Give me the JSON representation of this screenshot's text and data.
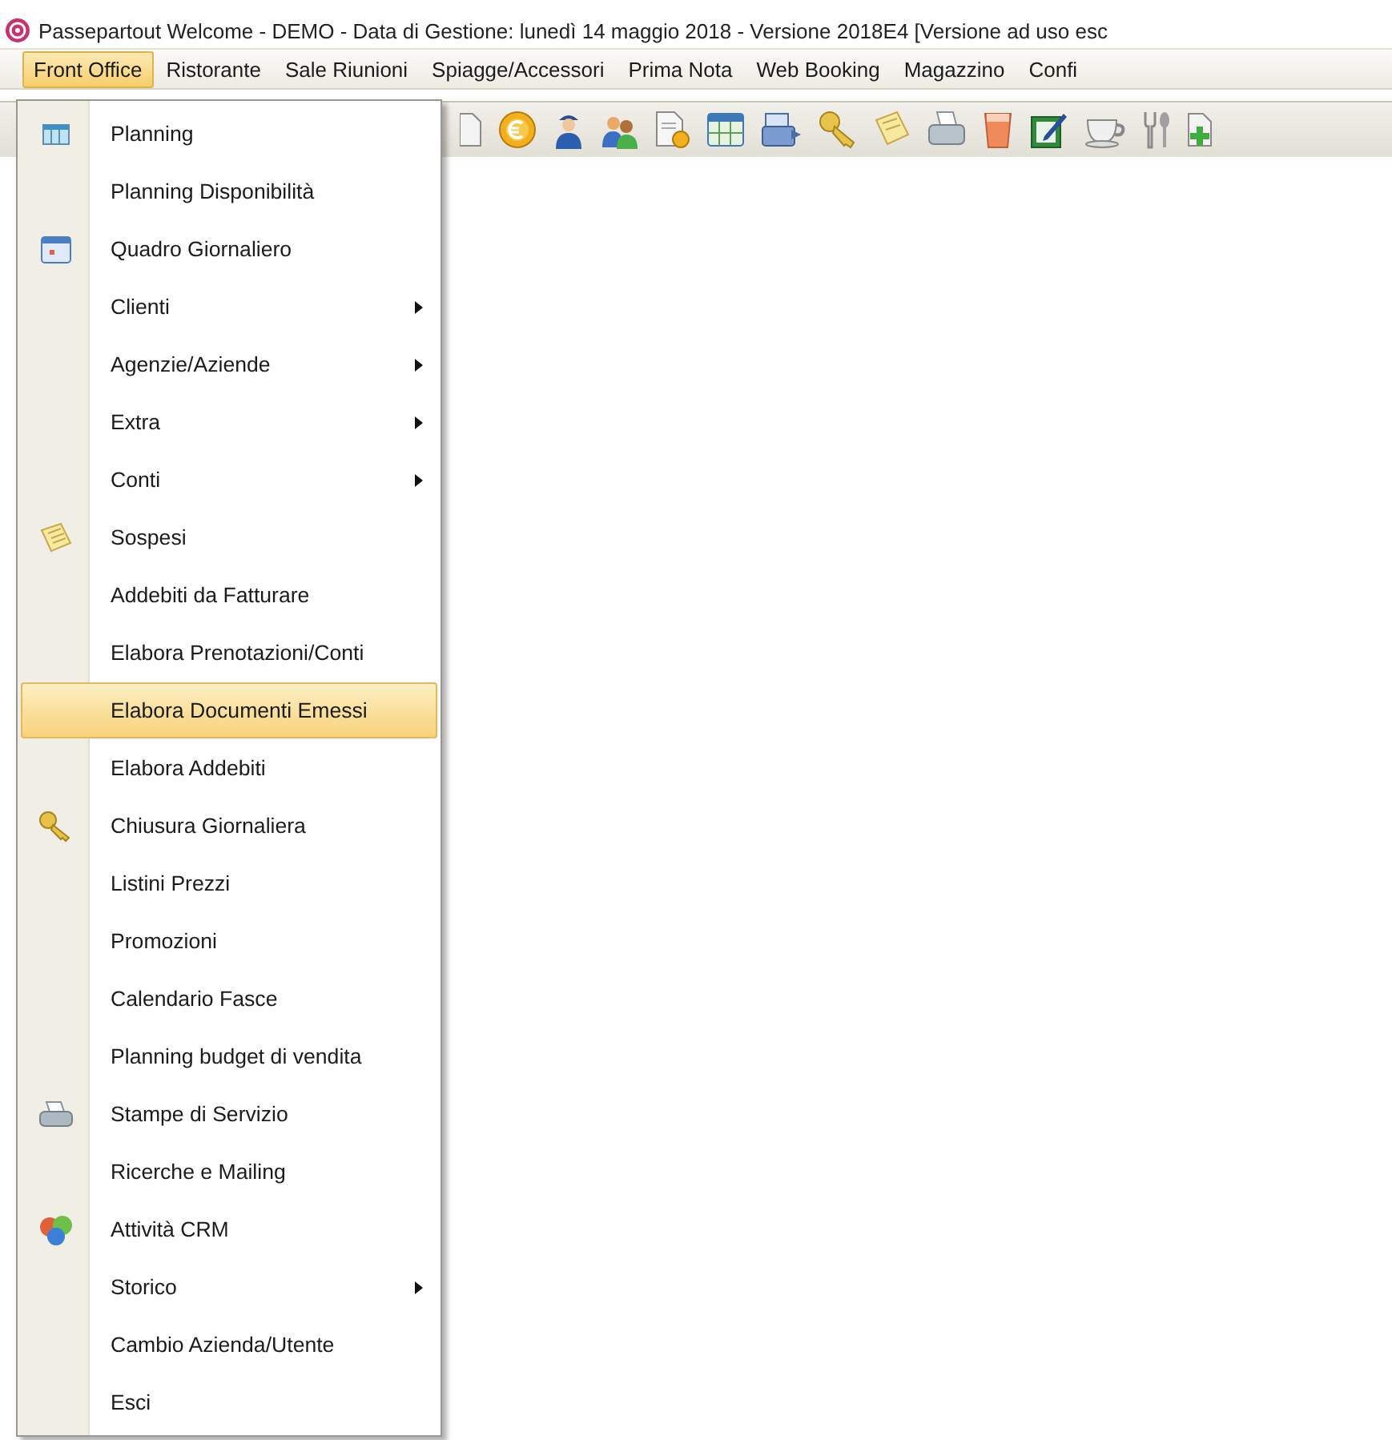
{
  "window": {
    "title": "Passepartout Welcome - DEMO - Data di Gestione: lunedì 14 maggio 2018 - Versione 2018E4 [Versione ad uso esc"
  },
  "menu_bar": [
    {
      "label": "Front Office",
      "selected": true
    },
    {
      "label": "Ristorante",
      "selected": false
    },
    {
      "label": "Sale Riunioni",
      "selected": false
    },
    {
      "label": "Spiagge/Accessori",
      "selected": false
    },
    {
      "label": "Prima Nota",
      "selected": false
    },
    {
      "label": "Web Booking",
      "selected": false
    },
    {
      "label": "Magazzino",
      "selected": false
    },
    {
      "label": "Confi",
      "selected": false
    }
  ],
  "dropdown_menu": {
    "items": [
      {
        "label": "Planning",
        "submenu": false,
        "selected": false
      },
      {
        "label": "Planning Disponibilità",
        "submenu": false,
        "selected": false
      },
      {
        "label": "Quadro Giornaliero",
        "submenu": false,
        "selected": false
      },
      {
        "label": "Clienti",
        "submenu": true,
        "selected": false
      },
      {
        "label": "Agenzie/Aziende",
        "submenu": true,
        "selected": false
      },
      {
        "label": "Extra",
        "submenu": true,
        "selected": false
      },
      {
        "label": "Conti",
        "submenu": true,
        "selected": false
      },
      {
        "label": "Sospesi",
        "submenu": false,
        "selected": false
      },
      {
        "label": "Addebiti da Fatturare",
        "submenu": false,
        "selected": false
      },
      {
        "label": "Elabora Prenotazioni/Conti",
        "submenu": false,
        "selected": false
      },
      {
        "label": "Elabora Documenti Emessi",
        "submenu": false,
        "selected": true
      },
      {
        "label": "Elabora Addebiti",
        "submenu": false,
        "selected": false
      },
      {
        "label": "Chiusura Giornaliera",
        "submenu": false,
        "selected": false
      },
      {
        "label": "Listini Prezzi",
        "submenu": false,
        "selected": false
      },
      {
        "label": "Promozioni",
        "submenu": false,
        "selected": false
      },
      {
        "label": "Calendario Fasce",
        "submenu": false,
        "selected": false
      },
      {
        "label": "Planning budget di vendita",
        "submenu": false,
        "selected": false
      },
      {
        "label": "Stampe di Servizio",
        "submenu": false,
        "selected": false
      },
      {
        "label": "Ricerche e Mailing",
        "submenu": false,
        "selected": false
      },
      {
        "label": "Attività CRM",
        "submenu": false,
        "selected": false
      },
      {
        "label": "Storico",
        "submenu": true,
        "selected": false
      },
      {
        "label": "Cambio Azienda/Utente",
        "submenu": false,
        "selected": false
      },
      {
        "label": "Esci",
        "submenu": false,
        "selected": false
      }
    ]
  }
}
